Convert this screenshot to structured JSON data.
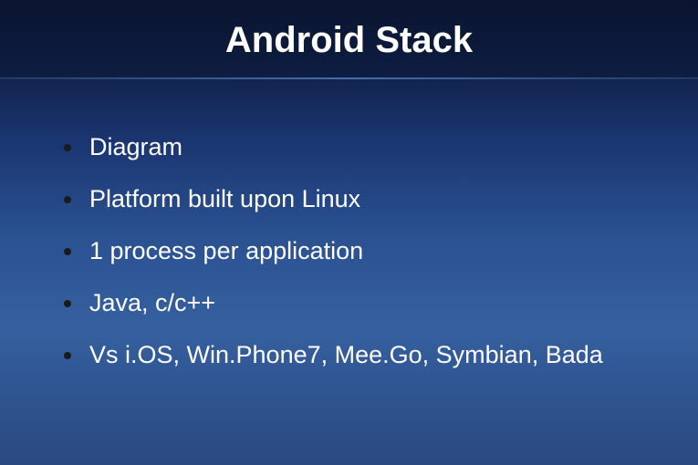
{
  "slide": {
    "title": "Android Stack",
    "bullets": [
      "Diagram",
      "Platform built upon Linux",
      "1 process per application",
      "Java, c/c++",
      "Vs i.OS, Win.Phone7, Mee.Go, Symbian, Bada"
    ]
  }
}
